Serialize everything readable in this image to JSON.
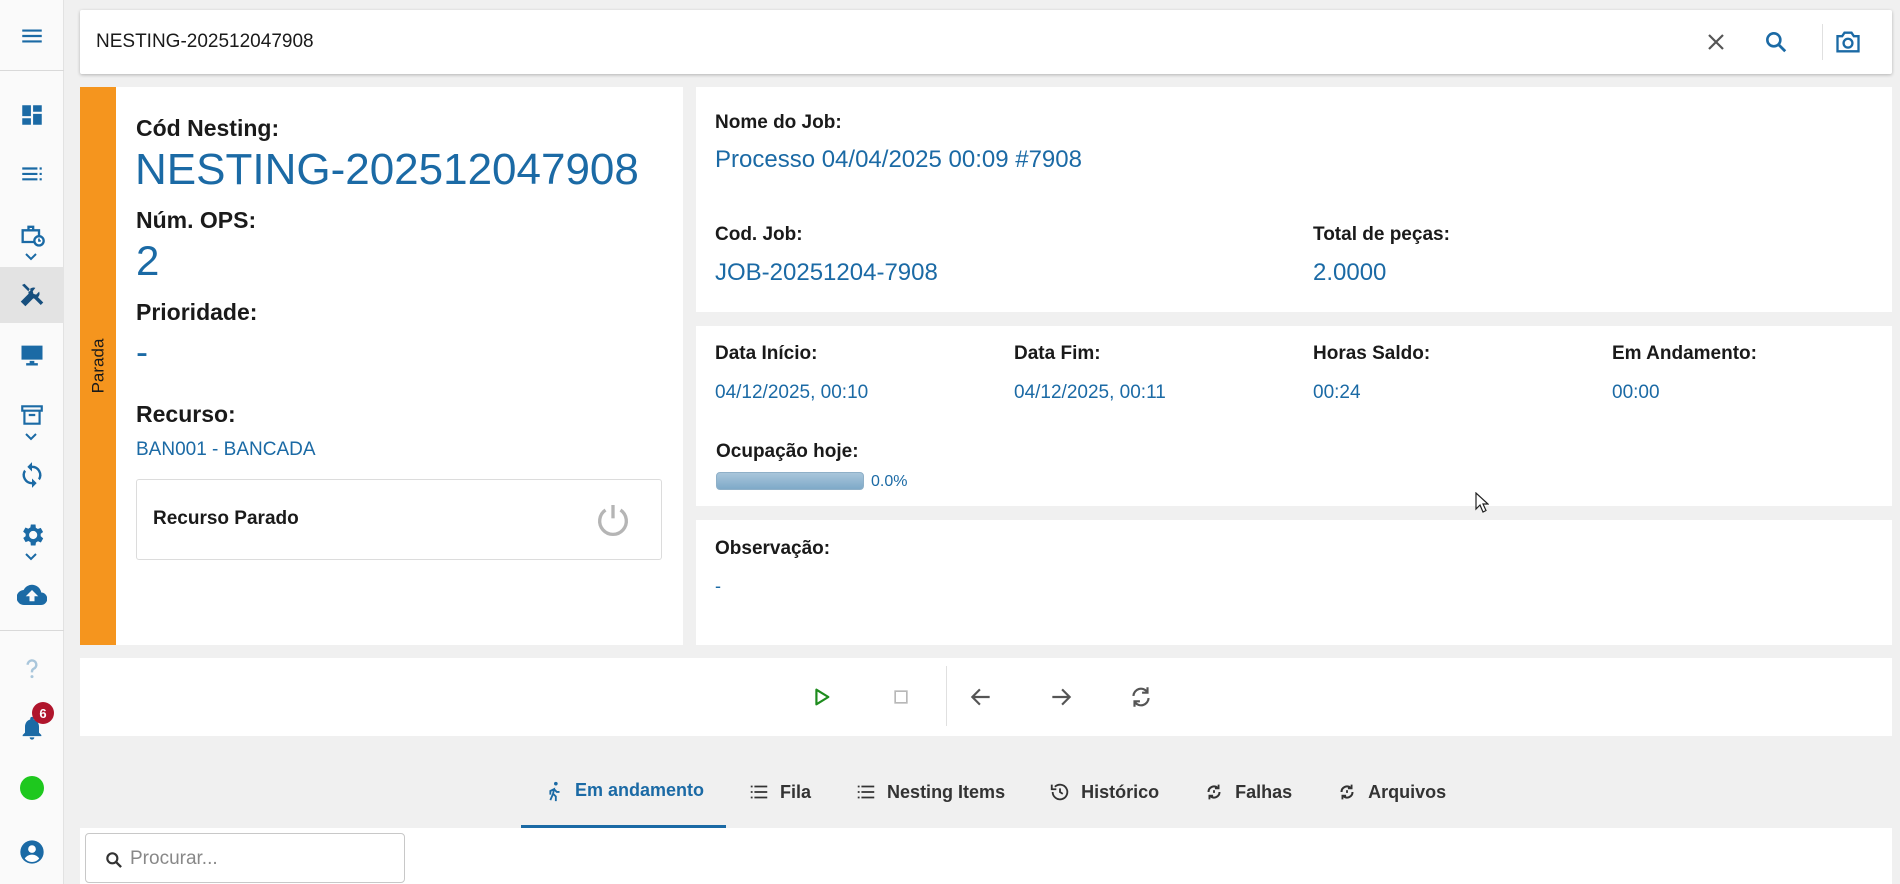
{
  "colors": {
    "accent": "#1b6aa5",
    "status_strip": "#f5951e",
    "badge": "#b0152c",
    "online": "#1ec81e"
  },
  "sidebar": {
    "items": [
      {
        "icon": "menu-icon"
      },
      {
        "icon": "dashboard-icon"
      },
      {
        "icon": "list-icon"
      },
      {
        "icon": "work-schedule-icon"
      },
      {
        "icon": "tools-icon",
        "active": true
      },
      {
        "icon": "monitor-icon"
      },
      {
        "icon": "archive-icon"
      },
      {
        "icon": "sync-icon"
      },
      {
        "icon": "gear-icon"
      },
      {
        "icon": "cloud-upload-icon"
      },
      {
        "icon": "help-icon"
      },
      {
        "icon": "bell-icon"
      },
      {
        "icon": "status-online-icon"
      },
      {
        "icon": "account-icon"
      }
    ],
    "notification_count": "6"
  },
  "search": {
    "value": "NESTING-202512047908"
  },
  "nesting": {
    "status": "Parada",
    "code_label": "Cód Nesting:",
    "code_value": "NESTING-202512047908",
    "ops_label": "Núm. OPS:",
    "ops_value": "2",
    "priority_label": "Prioridade:",
    "priority_value": "-",
    "resource_label": "Recurso:",
    "resource_value": "BAN001 - BANCADA",
    "resource_state": "Recurso Parado"
  },
  "job": {
    "name_label": "Nome do Job:",
    "name_value": "Processo 04/04/2025 00:09 #7908",
    "code_label": "Cod. Job:",
    "code_value": "JOB-20251204-7908",
    "total_label": "Total de peças:",
    "total_value": "2.0000"
  },
  "times": {
    "start_label": "Data Início:",
    "start_value": "04/12/2025, 00:10",
    "end_label": "Data Fim:",
    "end_value": "04/12/2025, 00:11",
    "balance_label": "Horas Saldo:",
    "balance_value": "00:24",
    "progress_label": "Em Andamento:",
    "progress_value": "00:00",
    "occupancy_label": "Ocupação hoje:",
    "occupancy_value": "0.0%",
    "occupancy_fraction": 0.0
  },
  "observation": {
    "label": "Observação:",
    "value": "-"
  },
  "tabs": [
    {
      "label": "Em andamento",
      "icon": "running-icon",
      "active": true
    },
    {
      "label": "Fila",
      "icon": "list-icon"
    },
    {
      "label": "Nesting Items",
      "icon": "list-icon"
    },
    {
      "label": "Histórico",
      "icon": "history-icon"
    },
    {
      "label": "Falhas",
      "icon": "cycle-icon"
    },
    {
      "label": "Arquivos",
      "icon": "cycle-icon"
    }
  ],
  "table_search": {
    "placeholder": "Procurar..."
  }
}
